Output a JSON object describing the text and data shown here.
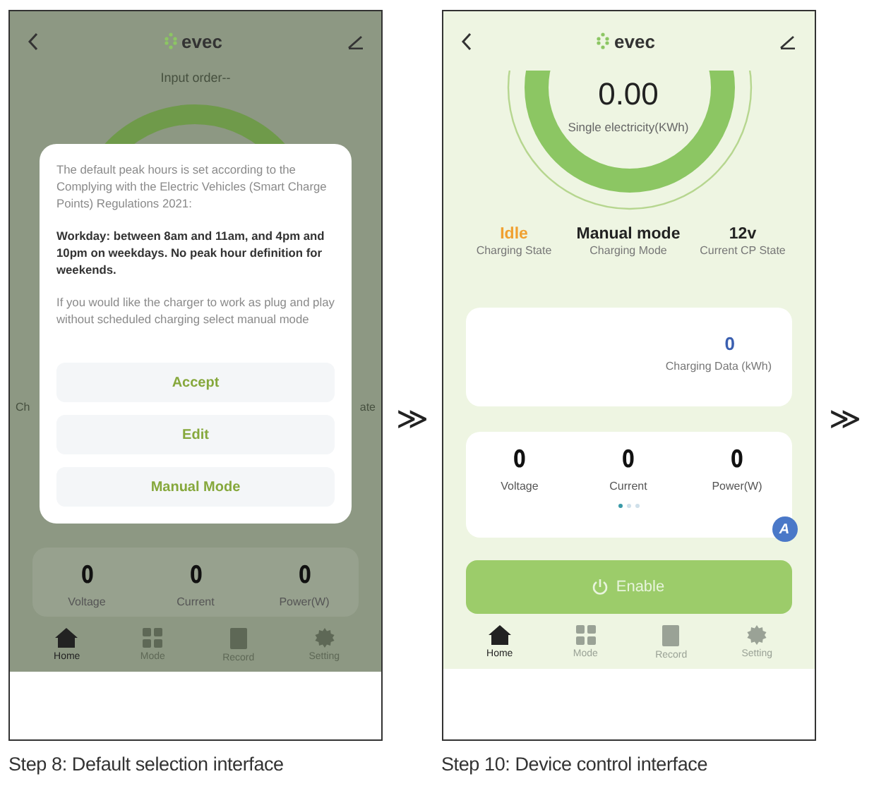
{
  "screens": [
    {
      "kind": "dialog",
      "logo": "evec",
      "subtitle": "Input order--",
      "fragments": [
        "Ch",
        "ate"
      ],
      "dialog": {
        "paragraphs": [
          {
            "text": "The default peak hours is set according to the Complying with the Electric Vehicles (Smart Charge Points) Regulations 2021:",
            "bold": false
          },
          {
            "text": "Workday: between 8am and 11am, and 4pm and 10pm on weekdays. No peak hour definition for weekends.",
            "bold": true
          },
          {
            "text": "If you would like the charger to work as plug and play without scheduled charging select manual mode",
            "bold": false
          }
        ],
        "buttons": [
          "Accept",
          "Edit",
          "Manual Mode"
        ]
      },
      "readings": [
        {
          "value": "0",
          "label": "Voltage"
        },
        {
          "value": "0",
          "label": "Current"
        },
        {
          "value": "0",
          "label": "Power(W)"
        }
      ],
      "nav": [
        {
          "label": "Home",
          "selected": true
        },
        {
          "label": "Mode",
          "selected": false
        },
        {
          "label": "Record",
          "selected": false
        },
        {
          "label": "Setting",
          "selected": false
        }
      ],
      "caption": "Step 8: Default selection interface",
      "arrow": "≫"
    },
    {
      "kind": "control",
      "logo": "evec",
      "gauge": {
        "value": "0.00",
        "label": "Single electricity(KWh)"
      },
      "status": [
        {
          "value": "Idle",
          "label": "Charging State",
          "color": "#f0a030"
        },
        {
          "value": "Manual mode",
          "label": "Charging Mode",
          "color": "#222222"
        },
        {
          "value": "12v",
          "label": "Current CP State",
          "color": "#222222"
        }
      ],
      "chart_card": {
        "value": "0",
        "label": "Charging Data (kWh)"
      },
      "readings": [
        {
          "value": "0",
          "label": "Voltage"
        },
        {
          "value": "0",
          "label": "Current"
        },
        {
          "value": "0",
          "label": "Power(W)"
        }
      ],
      "pages": [
        {
          "selected": true
        },
        {
          "selected": false
        },
        {
          "selected": false
        }
      ],
      "badge": "A",
      "enable": "Enable",
      "nav": [
        {
          "label": "Home",
          "selected": true
        },
        {
          "label": "Mode",
          "selected": false
        },
        {
          "label": "Record",
          "selected": false
        },
        {
          "label": "Setting",
          "selected": false
        }
      ],
      "caption": "Step 10: Device control  interface",
      "arrow": "≫"
    }
  ]
}
